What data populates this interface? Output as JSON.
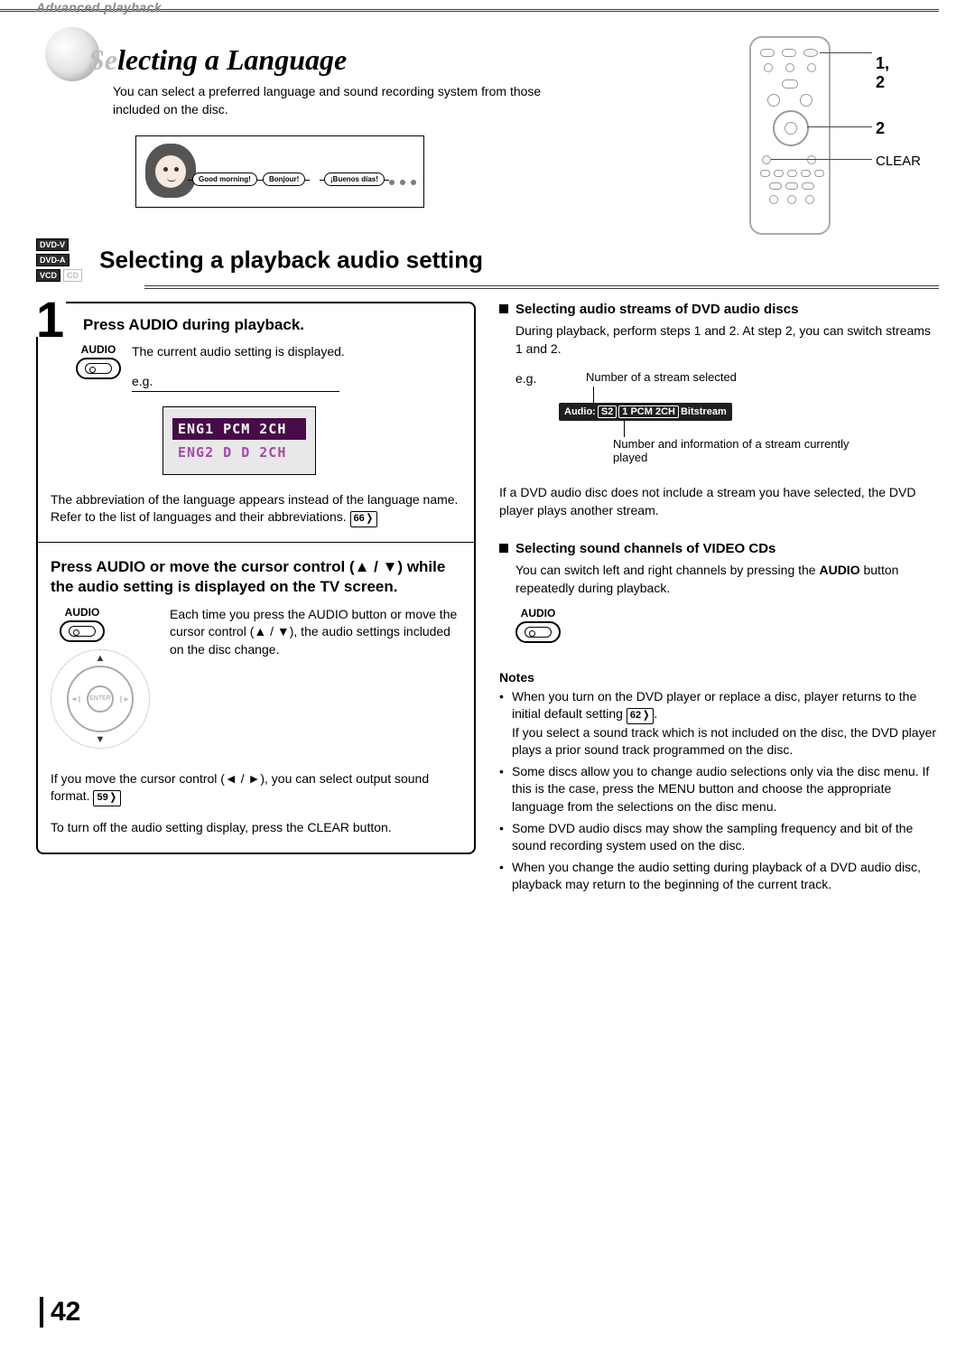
{
  "header_tab": "Advanced playback",
  "title_prefix": "Se",
  "title_rest": "lecting a Language",
  "title_desc": "You can select a preferred language and sound recording system from those included on the disc.",
  "greetings": {
    "g1": "Good morning!",
    "g2": "Bonjour!",
    "g3": "¡Buenos días!"
  },
  "remote": {
    "c1": "1, 2",
    "c2": "2",
    "c3": "CLEAR"
  },
  "badges": {
    "b1": "DVD-V",
    "b2": "DVD-A",
    "b3": "VCD",
    "b4": "CD"
  },
  "section_title": "Selecting a playback audio setting",
  "step1": {
    "heading": "Press AUDIO during playback.",
    "audio_label": "AUDIO",
    "desc": "The current audio setting is displayed.",
    "eg": "e.g.",
    "osd_line1": "ENG1 PCM 2CH",
    "osd_line2": "ENG2 D   D 2CH",
    "note_a": "The abbreviation of the language appears instead of the language name. Refer to the list of languages and their abbreviations. ",
    "ref66": "66"
  },
  "step2": {
    "heading": "Press AUDIO or move the cursor control (▲ / ▼) while the audio setting is displayed on the TV screen.",
    "audio_label": "AUDIO",
    "enter": "ENTER",
    "desc": "Each time you press the AUDIO button or move the cursor control (▲ / ▼), the audio settings included on the disc change.",
    "note_b_pre": "If you move the cursor control (◄ / ►), you can select output sound format. ",
    "ref59": "59",
    "note_c": "To turn off the audio setting display, press the CLEAR button."
  },
  "right": {
    "h1": "Selecting audio streams of DVD audio discs",
    "p1": "During playback, perform steps 1 and 2. At step 2, you can switch streams 1 and 2.",
    "eg": "e.g.",
    "ptr1": "Number of a stream selected",
    "bar_prefix": "Audio:",
    "bar_s2": "S2",
    "bar_mid": "1  PCM  2CH",
    "bar_suffix": "Bitstream",
    "ptr2": "Number and information of a stream currently played",
    "p2": "If a DVD audio disc does not include a stream you have selected, the DVD player plays another stream.",
    "h2": "Selecting sound channels of VIDEO CDs",
    "p3a": "You can switch left and right channels by pressing the ",
    "p3b": "AUDIO",
    "p3c": " button repeatedly during playback.",
    "audio_label": "AUDIO"
  },
  "notes_heading": "Notes",
  "notes": {
    "n1a": "When you turn on the DVD player or replace a disc, player returns to the initial default setting ",
    "ref62": "62",
    "n1b": ".",
    "n1c": "If you select a sound track which is not included on the disc, the DVD player plays a prior sound track programmed on the disc.",
    "n2": "Some discs allow you to change audio selections only via the disc menu.  If this is the case, press the MENU button and choose the appropriate language from the selections on the disc menu.",
    "n3": "Some DVD audio discs may show the sampling frequency and bit of the sound recording system used on the disc.",
    "n4": "When you change the audio setting during playback of a DVD audio disc, playback may return to the beginning of the current track."
  },
  "page_number": "42"
}
